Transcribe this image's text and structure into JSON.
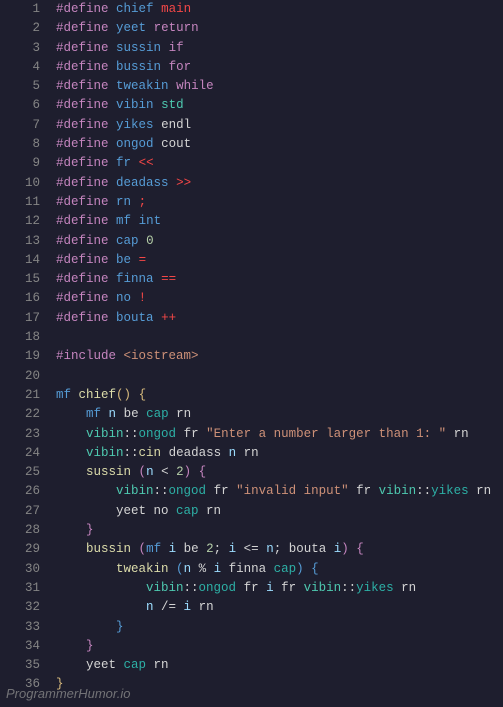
{
  "watermark": "ProgrammerHumor.io",
  "lines": [
    {
      "n": "1",
      "tokens": [
        [
          "c-pink",
          "#define"
        ],
        [
          "c-white",
          " "
        ],
        [
          "c-blue",
          "chief"
        ],
        [
          "c-white",
          " "
        ],
        [
          "c-red",
          "main"
        ]
      ]
    },
    {
      "n": "2",
      "tokens": [
        [
          "c-pink",
          "#define"
        ],
        [
          "c-white",
          " "
        ],
        [
          "c-blue",
          "yeet"
        ],
        [
          "c-white",
          " "
        ],
        [
          "c-pink",
          "return"
        ]
      ]
    },
    {
      "n": "3",
      "tokens": [
        [
          "c-pink",
          "#define"
        ],
        [
          "c-white",
          " "
        ],
        [
          "c-blue",
          "sussin"
        ],
        [
          "c-white",
          " "
        ],
        [
          "c-pink",
          "if"
        ]
      ]
    },
    {
      "n": "4",
      "tokens": [
        [
          "c-pink",
          "#define"
        ],
        [
          "c-white",
          " "
        ],
        [
          "c-blue",
          "bussin"
        ],
        [
          "c-white",
          " "
        ],
        [
          "c-pink",
          "for"
        ]
      ]
    },
    {
      "n": "5",
      "tokens": [
        [
          "c-pink",
          "#define"
        ],
        [
          "c-white",
          " "
        ],
        [
          "c-blue",
          "tweakin"
        ],
        [
          "c-white",
          " "
        ],
        [
          "c-pink",
          "while"
        ]
      ]
    },
    {
      "n": "6",
      "tokens": [
        [
          "c-pink",
          "#define"
        ],
        [
          "c-white",
          " "
        ],
        [
          "c-blue",
          "vibin"
        ],
        [
          "c-white",
          " "
        ],
        [
          "c-cyan",
          "std"
        ]
      ]
    },
    {
      "n": "7",
      "tokens": [
        [
          "c-pink",
          "#define"
        ],
        [
          "c-white",
          " "
        ],
        [
          "c-blue",
          "yikes"
        ],
        [
          "c-white",
          " "
        ],
        [
          "c-white",
          "endl"
        ]
      ]
    },
    {
      "n": "8",
      "tokens": [
        [
          "c-pink",
          "#define"
        ],
        [
          "c-white",
          " "
        ],
        [
          "c-blue",
          "ongod"
        ],
        [
          "c-white",
          " "
        ],
        [
          "c-white",
          "cout"
        ]
      ]
    },
    {
      "n": "9",
      "tokens": [
        [
          "c-pink",
          "#define"
        ],
        [
          "c-white",
          " "
        ],
        [
          "c-blue",
          "fr"
        ],
        [
          "c-white",
          " "
        ],
        [
          "c-red",
          "<<"
        ]
      ]
    },
    {
      "n": "10",
      "tokens": [
        [
          "c-pink",
          "#define"
        ],
        [
          "c-white",
          " "
        ],
        [
          "c-blue",
          "deadass"
        ],
        [
          "c-white",
          " "
        ],
        [
          "c-red",
          ">>"
        ]
      ]
    },
    {
      "n": "11",
      "tokens": [
        [
          "c-pink",
          "#define"
        ],
        [
          "c-white",
          " "
        ],
        [
          "c-blue",
          "rn"
        ],
        [
          "c-white",
          " "
        ],
        [
          "c-red",
          ";"
        ]
      ]
    },
    {
      "n": "12",
      "tokens": [
        [
          "c-pink",
          "#define"
        ],
        [
          "c-white",
          " "
        ],
        [
          "c-blue",
          "mf"
        ],
        [
          "c-white",
          " "
        ],
        [
          "c-blue",
          "int"
        ]
      ]
    },
    {
      "n": "13",
      "tokens": [
        [
          "c-pink",
          "#define"
        ],
        [
          "c-white",
          " "
        ],
        [
          "c-blue",
          "cap"
        ],
        [
          "c-white",
          " "
        ],
        [
          "c-num",
          "0"
        ]
      ]
    },
    {
      "n": "14",
      "tokens": [
        [
          "c-pink",
          "#define"
        ],
        [
          "c-white",
          " "
        ],
        [
          "c-blue",
          "be"
        ],
        [
          "c-white",
          " "
        ],
        [
          "c-red",
          "="
        ]
      ]
    },
    {
      "n": "15",
      "tokens": [
        [
          "c-pink",
          "#define"
        ],
        [
          "c-white",
          " "
        ],
        [
          "c-blue",
          "finna"
        ],
        [
          "c-white",
          " "
        ],
        [
          "c-red",
          "=="
        ]
      ]
    },
    {
      "n": "16",
      "tokens": [
        [
          "c-pink",
          "#define"
        ],
        [
          "c-white",
          " "
        ],
        [
          "c-blue",
          "no"
        ],
        [
          "c-white",
          " "
        ],
        [
          "c-red",
          "!"
        ]
      ]
    },
    {
      "n": "17",
      "tokens": [
        [
          "c-pink",
          "#define"
        ],
        [
          "c-white",
          " "
        ],
        [
          "c-blue",
          "bouta"
        ],
        [
          "c-white",
          " "
        ],
        [
          "c-red",
          "++"
        ]
      ]
    },
    {
      "n": "18",
      "tokens": [
        [
          "c-white",
          ""
        ]
      ]
    },
    {
      "n": "19",
      "tokens": [
        [
          "c-pink",
          "#include"
        ],
        [
          "c-white",
          " "
        ],
        [
          "c-orange",
          "<iostream>"
        ]
      ]
    },
    {
      "n": "20",
      "tokens": [
        [
          "c-white",
          ""
        ]
      ]
    },
    {
      "n": "21",
      "tokens": [
        [
          "c-blue",
          "mf"
        ],
        [
          "c-white",
          " "
        ],
        [
          "c-yellow",
          "chief"
        ],
        [
          "c-gold",
          "()"
        ],
        [
          "c-white",
          " "
        ],
        [
          "c-gold",
          "{"
        ]
      ]
    },
    {
      "n": "22",
      "tokens": [
        [
          "c-white",
          "    "
        ],
        [
          "c-blue",
          "mf"
        ],
        [
          "c-white",
          " "
        ],
        [
          "c-lblue",
          "n"
        ],
        [
          "c-white",
          " be "
        ],
        [
          "c-teal",
          "cap"
        ],
        [
          "c-white",
          " rn"
        ]
      ]
    },
    {
      "n": "23",
      "tokens": [
        [
          "c-white",
          "    "
        ],
        [
          "c-cyan",
          "vibin"
        ],
        [
          "c-white",
          "::"
        ],
        [
          "c-teal",
          "ongod"
        ],
        [
          "c-white",
          " fr "
        ],
        [
          "c-orange",
          "\"Enter a number larger than 1: \""
        ],
        [
          "c-white",
          " rn"
        ]
      ]
    },
    {
      "n": "24",
      "tokens": [
        [
          "c-white",
          "    "
        ],
        [
          "c-cyan",
          "vibin"
        ],
        [
          "c-white",
          "::"
        ],
        [
          "c-yellow",
          "cin"
        ],
        [
          "c-white",
          " deadass "
        ],
        [
          "c-lblue",
          "n"
        ],
        [
          "c-white",
          " rn"
        ]
      ]
    },
    {
      "n": "25",
      "tokens": [
        [
          "c-white",
          "    "
        ],
        [
          "c-yellow",
          "sussin"
        ],
        [
          "c-white",
          " "
        ],
        [
          "c-pink",
          "("
        ],
        [
          "c-lblue",
          "n"
        ],
        [
          "c-white",
          " < "
        ],
        [
          "c-num",
          "2"
        ],
        [
          "c-pink",
          ")"
        ],
        [
          "c-white",
          " "
        ],
        [
          "c-pink",
          "{"
        ]
      ]
    },
    {
      "n": "26",
      "tokens": [
        [
          "c-white",
          "        "
        ],
        [
          "c-cyan",
          "vibin"
        ],
        [
          "c-white",
          "::"
        ],
        [
          "c-teal",
          "ongod"
        ],
        [
          "c-white",
          " fr "
        ],
        [
          "c-orange",
          "\"invalid input\""
        ],
        [
          "c-white",
          " fr "
        ],
        [
          "c-cyan",
          "vibin"
        ],
        [
          "c-white",
          "::"
        ],
        [
          "c-teal",
          "yikes"
        ],
        [
          "c-white",
          " rn"
        ]
      ]
    },
    {
      "n": "27",
      "tokens": [
        [
          "c-white",
          "        yeet no "
        ],
        [
          "c-teal",
          "cap"
        ],
        [
          "c-white",
          " rn"
        ]
      ]
    },
    {
      "n": "28",
      "tokens": [
        [
          "c-white",
          "    "
        ],
        [
          "c-pink",
          "}"
        ]
      ]
    },
    {
      "n": "29",
      "tokens": [
        [
          "c-white",
          "    "
        ],
        [
          "c-yellow",
          "bussin"
        ],
        [
          "c-white",
          " "
        ],
        [
          "c-pink",
          "("
        ],
        [
          "c-blue",
          "mf"
        ],
        [
          "c-white",
          " "
        ],
        [
          "c-lblue",
          "i"
        ],
        [
          "c-white",
          " be "
        ],
        [
          "c-num",
          "2"
        ],
        [
          "c-white",
          "; "
        ],
        [
          "c-lblue",
          "i"
        ],
        [
          "c-white",
          " <= "
        ],
        [
          "c-lblue",
          "n"
        ],
        [
          "c-white",
          "; bouta "
        ],
        [
          "c-lblue",
          "i"
        ],
        [
          "c-pink",
          ")"
        ],
        [
          "c-white",
          " "
        ],
        [
          "c-pink",
          "{"
        ]
      ]
    },
    {
      "n": "30",
      "tokens": [
        [
          "c-white",
          "        "
        ],
        [
          "c-yellow",
          "tweakin"
        ],
        [
          "c-white",
          " "
        ],
        [
          "c-blue",
          "("
        ],
        [
          "c-lblue",
          "n"
        ],
        [
          "c-white",
          " % "
        ],
        [
          "c-lblue",
          "i"
        ],
        [
          "c-white",
          " finna "
        ],
        [
          "c-teal",
          "cap"
        ],
        [
          "c-blue",
          ")"
        ],
        [
          "c-white",
          " "
        ],
        [
          "c-blue",
          "{"
        ]
      ]
    },
    {
      "n": "31",
      "tokens": [
        [
          "c-white",
          "            "
        ],
        [
          "c-cyan",
          "vibin"
        ],
        [
          "c-white",
          "::"
        ],
        [
          "c-teal",
          "ongod"
        ],
        [
          "c-white",
          " fr "
        ],
        [
          "c-lblue",
          "i"
        ],
        [
          "c-white",
          " fr "
        ],
        [
          "c-cyan",
          "vibin"
        ],
        [
          "c-white",
          "::"
        ],
        [
          "c-teal",
          "yikes"
        ],
        [
          "c-white",
          " rn"
        ]
      ]
    },
    {
      "n": "32",
      "tokens": [
        [
          "c-white",
          "            "
        ],
        [
          "c-lblue",
          "n"
        ],
        [
          "c-white",
          " /= "
        ],
        [
          "c-lblue",
          "i"
        ],
        [
          "c-white",
          " rn"
        ]
      ]
    },
    {
      "n": "33",
      "tokens": [
        [
          "c-white",
          "        "
        ],
        [
          "c-blue",
          "}"
        ]
      ]
    },
    {
      "n": "34",
      "tokens": [
        [
          "c-white",
          "    "
        ],
        [
          "c-pink",
          "}"
        ]
      ]
    },
    {
      "n": "35",
      "tokens": [
        [
          "c-white",
          "    yeet "
        ],
        [
          "c-teal",
          "cap"
        ],
        [
          "c-white",
          " rn"
        ]
      ]
    },
    {
      "n": "36",
      "tokens": [
        [
          "c-gold",
          "}"
        ]
      ]
    }
  ]
}
